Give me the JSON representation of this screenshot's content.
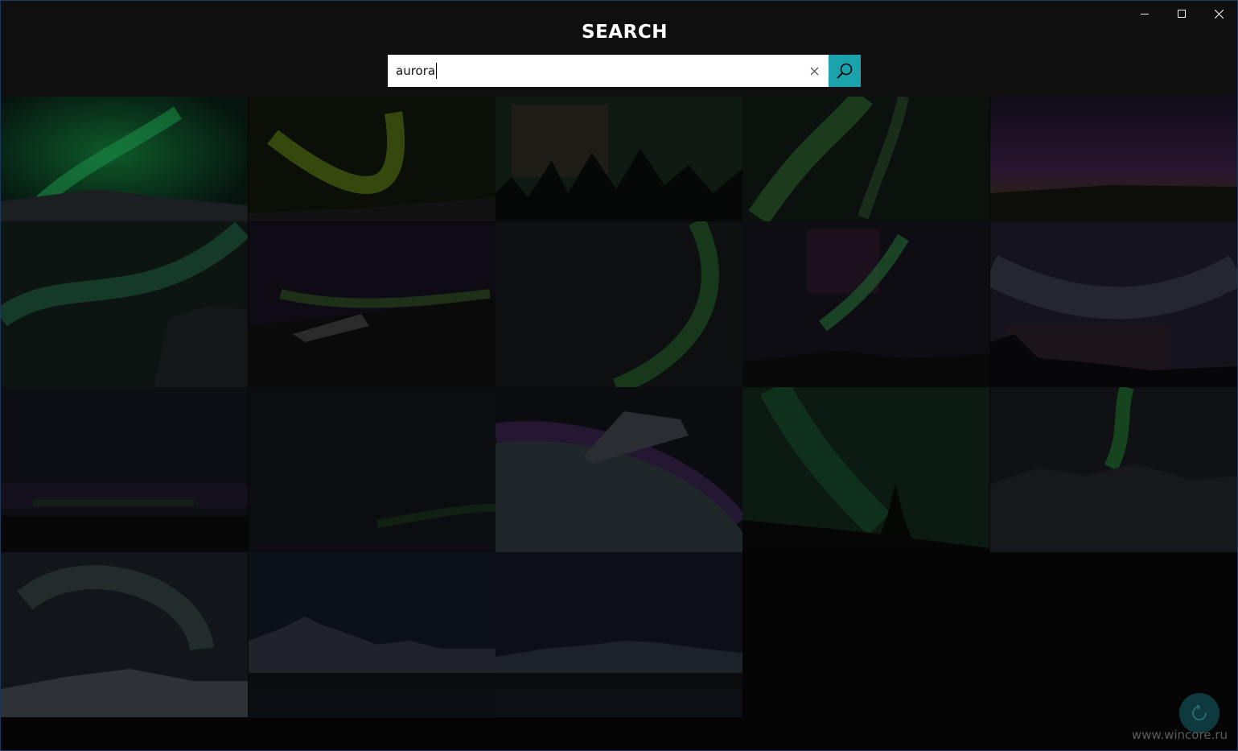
{
  "header": {
    "title": "SEARCH"
  },
  "search": {
    "value": "aurora",
    "clear_icon": "close-icon",
    "search_icon": "search-icon",
    "accent_color": "#1aa3ad"
  },
  "window_controls": [
    {
      "name": "minimize-icon"
    },
    {
      "name": "maximize-icon"
    },
    {
      "name": "close-icon"
    }
  ],
  "results": [
    {
      "style": "green-arc-mountain"
    },
    {
      "style": "yellow-green-horizon"
    },
    {
      "style": "green-pink-forest"
    },
    {
      "style": "green-diagonal"
    },
    {
      "style": "purple-horizon"
    },
    {
      "style": "green-swirl-rock"
    },
    {
      "style": "purple-plane-wreck"
    },
    {
      "style": "green-curve-dark"
    },
    {
      "style": "green-pink-mountain"
    },
    {
      "style": "grey-purple-trees"
    },
    {
      "style": "faint-purple-horizon"
    },
    {
      "style": "faint-green-dark"
    },
    {
      "style": "earth-from-space"
    },
    {
      "style": "green-tree"
    },
    {
      "style": "green-mountains-snow"
    },
    {
      "style": "grey-swirl-snow"
    },
    {
      "style": "mountain-lake-night"
    },
    {
      "style": "mountain-range-night"
    }
  ],
  "refresh_icon": "refresh-icon",
  "watermark": "www.wincore.ru"
}
